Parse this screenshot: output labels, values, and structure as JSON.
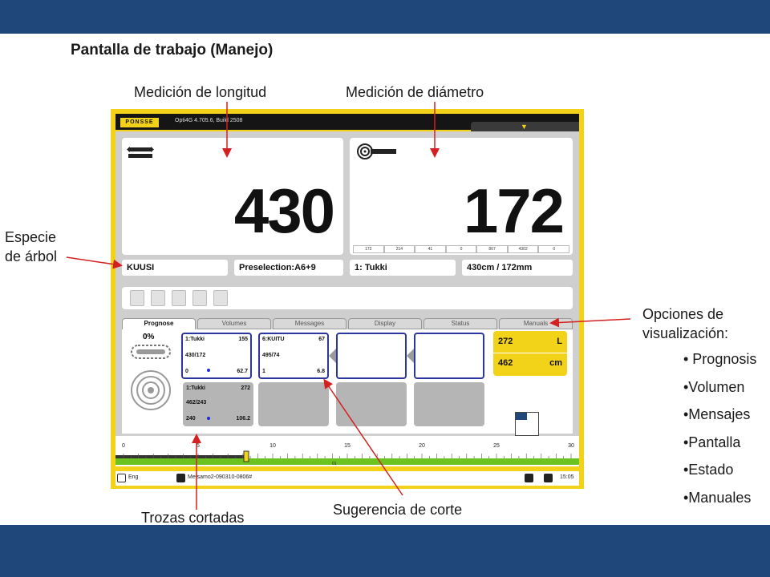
{
  "slide": {
    "title": "Pantalla de trabajo (Manejo)",
    "callouts": {
      "length": "Medición de longitud",
      "diameter": "Medición de diámetro",
      "species_line1": "Especie",
      "species_line2": "de árbol",
      "options_line1": "Opciones de",
      "options_line2": "visualización:",
      "cut_logs": "Trozas cortadas",
      "cut_suggestion": "Sugerencia de corte"
    },
    "bullets": [
      "• Prognosis",
      "•Volumen",
      "•Mensajes",
      "•Pantalla",
      "•Estado",
      "•Manuales"
    ],
    "colors": {
      "band": "#1f477a",
      "arrow": "#d42020",
      "screen_frame": "#f3d21a"
    }
  },
  "app": {
    "logo": "PONSSE",
    "version": "Opti4G 4.705.6, Build 2508",
    "length_value": "430",
    "diameter_value": "172",
    "diameter_row": [
      "172",
      "214",
      "41",
      "0",
      "867",
      "4302",
      "0"
    ],
    "species": "KUUSI",
    "preselection": "Preselection:A6+9",
    "assortment": "1: Tukki",
    "dimensions": "430cm / 172mm",
    "tabs": [
      "Prognose",
      "Volumes",
      "Messages",
      "Display",
      "Status",
      "Manuals"
    ],
    "active_tab": "Prognose",
    "prognose_pct": "0%",
    "cut_log": {
      "name": "1:Tukki",
      "val1": "272",
      "dims": "462/243",
      "left": "240",
      "right": "106.2"
    },
    "suggestions": [
      {
        "name": "1:Tukki",
        "val1": "155",
        "dims": "430/172",
        "left": "0",
        "right": "62.7"
      },
      {
        "name": "6:KUITU",
        "val1": "67",
        "dims": "495/74",
        "left": "1",
        "right": "6.8"
      }
    ],
    "len_box": {
      "val1": "272",
      "unit1": "L",
      "val2": "462",
      "unit2": "cm"
    },
    "ruler_ticks": [
      "0",
      "5",
      "10",
      "15",
      "20",
      "25",
      "30"
    ],
    "ruler_sub": "01",
    "status": {
      "lang": "Eng",
      "file": "Metsamo2-090310-0806#",
      "time": "15:05"
    }
  }
}
